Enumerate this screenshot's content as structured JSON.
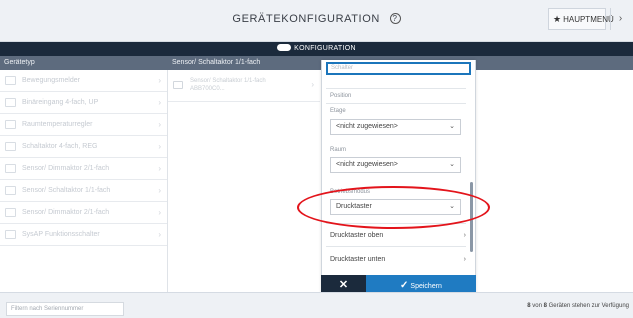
{
  "header": {
    "title": "GERÄTEKONFIGURATION",
    "help_icon": "?",
    "main_menu_label": "HAUPTMENÜ",
    "next_icon": "›"
  },
  "konfig_bar": {
    "label": "KONFIGURATION"
  },
  "columns": {
    "col1": "Gerätetyp",
    "col2": "Sensor/ Schaltaktor 1/1-fach"
  },
  "device_list": [
    "Bewegungsmelder",
    "Binäreingang 4-fach, UP",
    "Raumtemperaturregler",
    "Schaltaktor 4-fach, REG",
    "Sensor/ Dimmaktor 2/1-fach",
    "Sensor/ Schaltaktor 1/1-fach",
    "Sensor/ Dimmaktor 2/1-fach",
    "SysAP Funktionsschalter"
  ],
  "sub_list": [
    {
      "line1": "Sensor/ Schaltaktor 1/1-fach",
      "line2": "ABB700C0..."
    }
  ],
  "panel": {
    "name_placeholder": "Schalter",
    "position_label": "Position",
    "etage_label": "Etage",
    "etage_value": "<nicht zugewiesen>",
    "raum_label": "Raum",
    "raum_value": "<nicht zugewiesen>",
    "mode_label": "Betriebsmodus",
    "mode_value": "Drucktaster",
    "link_top": "Drucktaster oben",
    "link_bottom": "Drucktaster unten"
  },
  "actions": {
    "cancel_icon": "✕",
    "save_label": "Speichern"
  },
  "footer": {
    "sort_label": "Filtern nach Seriennummer",
    "status_count": "8",
    "status_mid": " von ",
    "status_total": "8",
    "status_suffix": " Geräten stehen zur Verfügung"
  },
  "colors": {
    "accent": "#1f7bc2",
    "navy": "#1b2a3c",
    "highlight": "#e3141b"
  }
}
